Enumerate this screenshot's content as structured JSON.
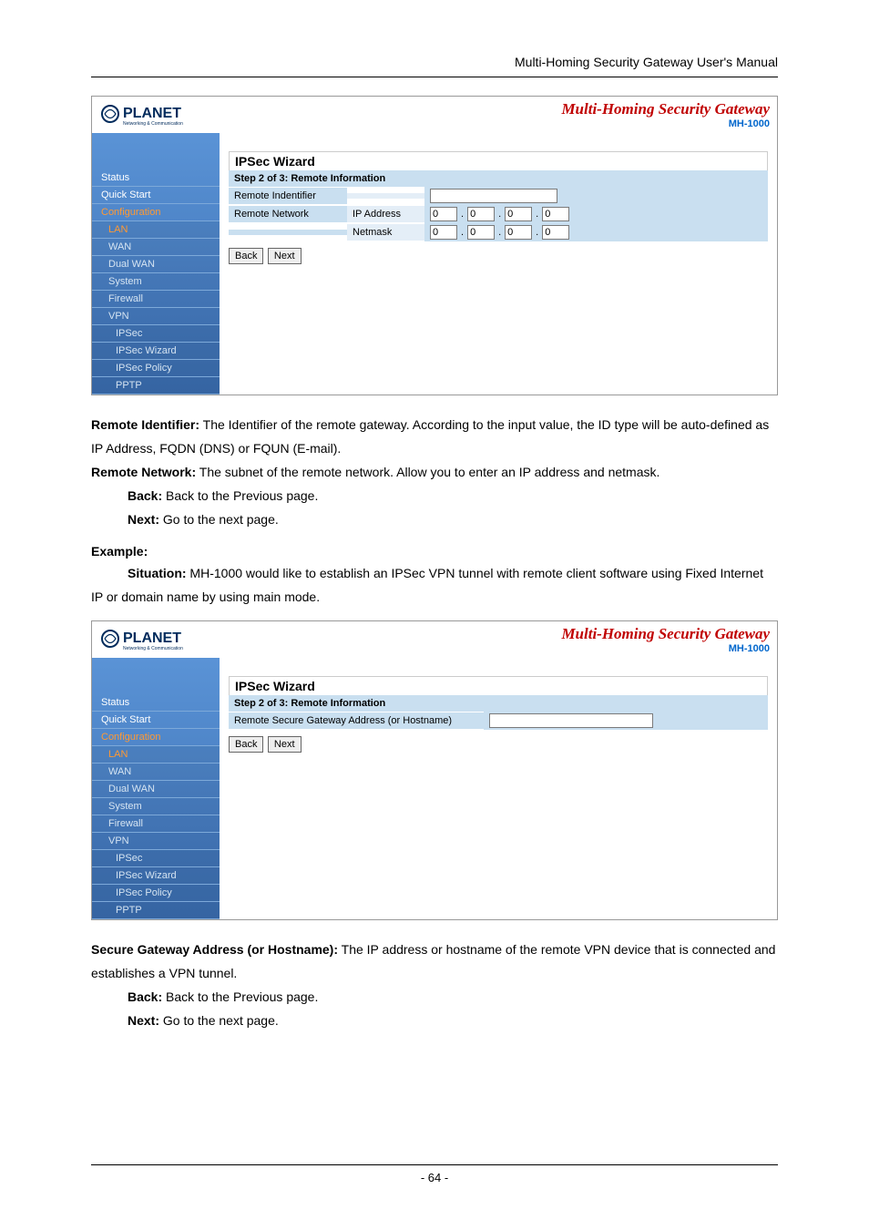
{
  "doc_header": "Multi-Homing Security Gateway User's Manual",
  "banner": {
    "title": "Multi-Homing Security Gateway",
    "model": "MH-1000",
    "logo_main": "PLANET",
    "logo_sub": "Networking & Communication"
  },
  "nav": {
    "status": "Status",
    "quickstart": "Quick Start",
    "config": "Configuration",
    "lan": "LAN",
    "wan": "WAN",
    "dualwan": "Dual WAN",
    "system": "System",
    "firewall": "Firewall",
    "vpn": "VPN",
    "ipsec": "IPSec",
    "ipsecwiz": "IPSec Wizard",
    "ipsecpol": "IPSec Policy",
    "pptp": "PPTP"
  },
  "wizard1": {
    "title": "IPSec Wizard",
    "step": "Step 2 of 3: Remote Information",
    "row_identifier": "Remote Indentifier",
    "row_network": "Remote Network",
    "ipaddr": "IP Address",
    "netmask": "Netmask",
    "ip_a": [
      "0",
      "0",
      "0",
      "0"
    ],
    "ip_b": [
      "0",
      "0",
      "0",
      "0"
    ],
    "back": "Back",
    "next": "Next"
  },
  "wizard2": {
    "title": "IPSec Wizard",
    "step": "Step 2 of 3: Remote Information",
    "row_host": "Remote Secure Gateway Address (or Hostname)",
    "host_value": "",
    "back": "Back",
    "next": "Next"
  },
  "desc1": {
    "rid_label": "Remote Identifier:",
    "rid_text": " The Identifier of the remote gateway. According to the input value, the ID type will be auto-defined as IP Address, FQDN (DNS) or FQUN (E-mail).",
    "rnet_label": "Remote Network:",
    "rnet_text": " The subnet of the remote network. Allow you to enter an IP address and netmask.",
    "back_label": "Back:",
    "back_text": " Back to the Previous page.",
    "next_label": "Next:",
    "next_text": " Go to the next page."
  },
  "example": {
    "head": "Example:",
    "para_label": "Situation:",
    "para_text": " MH-1000 would like to establish an IPSec VPN tunnel with remote client software using Fixed Internet IP or domain name by using main mode."
  },
  "desc2": {
    "host_label": "Secure Gateway Address (or Hostname):",
    "host_text": " The IP address or hostname of the remote VPN device that is connected and establishes a VPN tunnel.",
    "back_label": "Back:",
    "back_text": " Back to the Previous page.",
    "next_label": "Next:",
    "next_text": " Go to the next page."
  },
  "page_num": "- 64 -"
}
